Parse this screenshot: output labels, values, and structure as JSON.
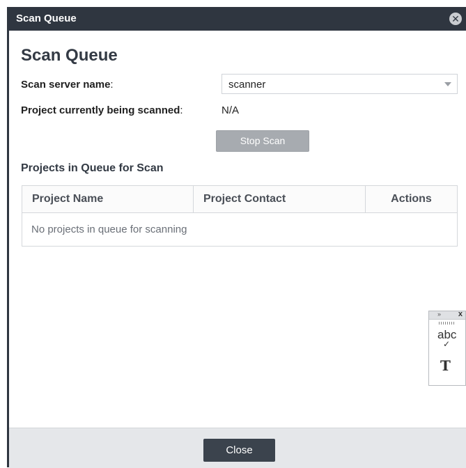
{
  "dialog": {
    "title": "Scan Queue",
    "close_icon_glyph": "✕"
  },
  "content": {
    "heading": "Scan Queue",
    "server_label": "Scan server name",
    "server_value": "scanner",
    "current_label": "Project currently being scanned",
    "current_value": "N/A",
    "stop_button": "Stop Scan",
    "queue_heading": "Projects in Queue for Scan",
    "table": {
      "columns": [
        "Project Name",
        "Project Contact",
        "Actions"
      ],
      "empty_message": "No projects in queue for scanning"
    }
  },
  "spellcheck_widget": {
    "arrows": "»",
    "close": "x",
    "abc": "abc",
    "check": "✓",
    "t_icon": "T"
  },
  "footer": {
    "close_button": "Close"
  },
  "colors": {
    "titlebar": "#2f3640",
    "stop_button_disabled": "#a7abb0",
    "close_button": "#3b434d",
    "footer_bg": "#e5e7ea"
  }
}
